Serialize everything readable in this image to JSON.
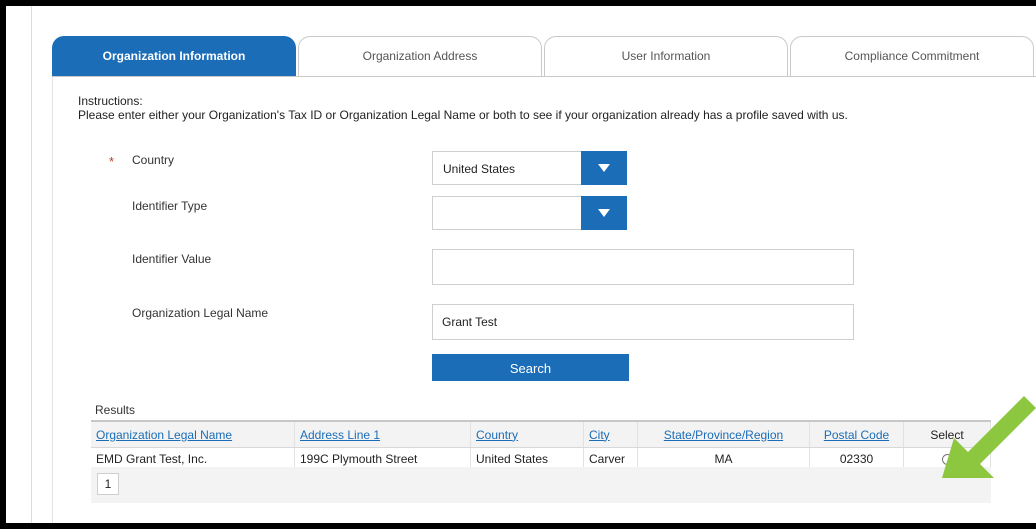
{
  "tabs": [
    {
      "label": "Organization Information",
      "active": true
    },
    {
      "label": "Organization Address",
      "active": false
    },
    {
      "label": "User Information",
      "active": false
    },
    {
      "label": "Compliance Commitment",
      "active": false
    }
  ],
  "instructions": {
    "heading": "Instructions:",
    "text": "Please enter either your Organization's Tax ID or Organization Legal Name or both to see if your organization already has a profile saved with us."
  },
  "form": {
    "required_marker": "*",
    "country_label": "Country",
    "country_value": "United States",
    "identifier_type_label": "Identifier Type",
    "identifier_type_value": "",
    "identifier_value_label": "Identifier Value",
    "identifier_value_value": "",
    "legal_name_label": "Organization Legal Name",
    "legal_name_value": "Grant Test",
    "search_label": "Search"
  },
  "results": {
    "label": "Results",
    "columns": [
      "Organization Legal Name",
      "Address Line 1",
      "Country",
      "City",
      "State/Province/Region",
      "Postal Code",
      "Select"
    ],
    "rows": [
      [
        "EMD Grant Test, Inc.",
        "199C Plymouth Street",
        "United States",
        "Carver",
        "MA",
        "02330"
      ]
    ],
    "page": "1"
  },
  "colors": {
    "accent": "#1b6db7",
    "annotation_arrow": "#8dc63f"
  }
}
